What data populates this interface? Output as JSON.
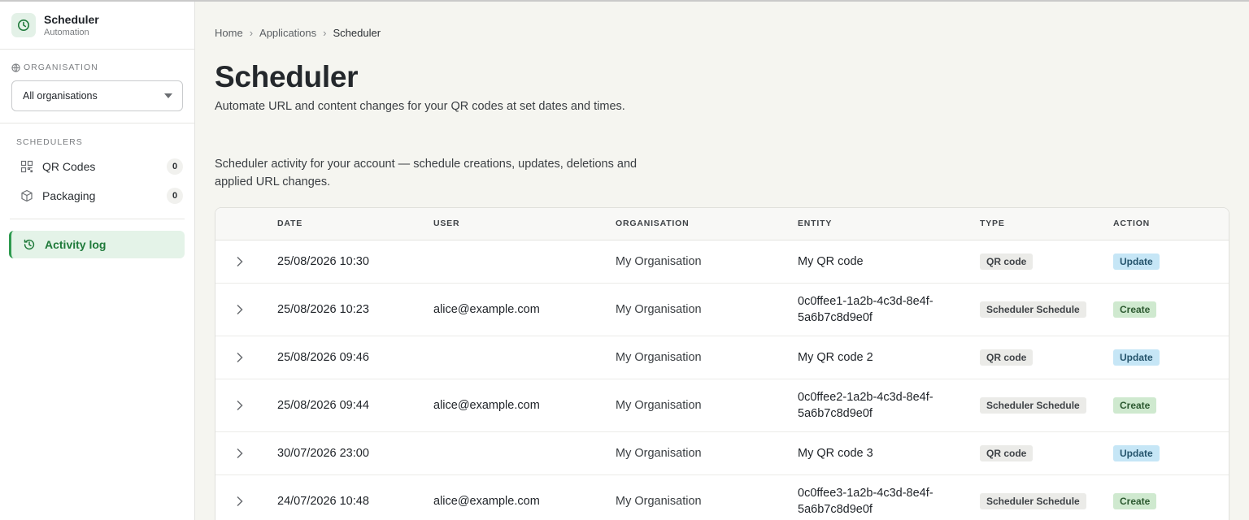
{
  "app": {
    "title": "Scheduler",
    "subtitle": "Automation"
  },
  "organisation": {
    "label": "ORGANISATION",
    "selected": "All organisations"
  },
  "schedulers": {
    "label": "SCHEDULERS",
    "items": [
      {
        "label": "QR Codes",
        "count": "0",
        "icon": "qr-grid-icon"
      },
      {
        "label": "Packaging",
        "count": "0",
        "icon": "box-icon"
      }
    ]
  },
  "activity_log": {
    "label": "Activity log",
    "icon": "history-icon"
  },
  "breadcrumb": [
    "Home",
    "Applications",
    "Scheduler"
  ],
  "page": {
    "title": "Scheduler",
    "subtitle": "Automate URL and content changes for your QR codes at set dates and times.",
    "description": "Scheduler activity for your account — schedule creations, updates, deletions and applied URL changes."
  },
  "table": {
    "headers": {
      "date": "DATE",
      "user": "USER",
      "organisation": "ORGANISATION",
      "entity": "ENTITY",
      "type": "TYPE",
      "action": "ACTION"
    },
    "rows": [
      {
        "date": "25/08/2026 10:30",
        "user": "",
        "organisation": "My Organisation",
        "entity1": "My QR code",
        "entity2": "",
        "type": "QR code",
        "action": "Update"
      },
      {
        "date": "25/08/2026 10:23",
        "user": "alice@example.com",
        "organisation": "My Organisation",
        "entity1": "0c0ffee1-1a2b-4c3d-8e4f-",
        "entity2": "5a6b7c8d9e0f",
        "type": "Scheduler Schedule",
        "action": "Create"
      },
      {
        "date": "25/08/2026 09:46",
        "user": "",
        "organisation": "My Organisation",
        "entity1": "My QR code 2",
        "entity2": "",
        "type": "QR code",
        "action": "Update"
      },
      {
        "date": "25/08/2026 09:44",
        "user": "alice@example.com",
        "organisation": "My Organisation",
        "entity1": "0c0ffee2-1a2b-4c3d-8e4f-",
        "entity2": "5a6b7c8d9e0f",
        "type": "Scheduler Schedule",
        "action": "Create"
      },
      {
        "date": "30/07/2026 23:00",
        "user": "",
        "organisation": "My Organisation",
        "entity1": "My QR code 3",
        "entity2": "",
        "type": "QR code",
        "action": "Update"
      },
      {
        "date": "24/07/2026 10:48",
        "user": "alice@example.com",
        "organisation": "My Organisation",
        "entity1": "0c0ffee3-1a2b-4c3d-8e4f-",
        "entity2": "5a6b7c8d9e0f",
        "type": "Scheduler Schedule",
        "action": "Create"
      }
    ]
  },
  "colors": {
    "accent": "#1f7a3a",
    "update": "#c6e6f6",
    "create": "#cfe9cf"
  }
}
